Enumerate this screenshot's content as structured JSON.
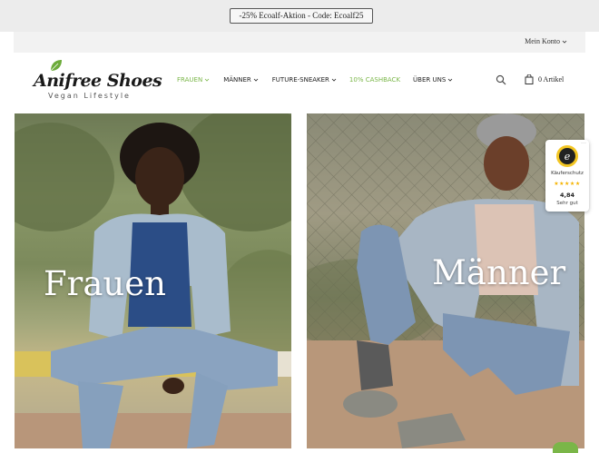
{
  "promo": {
    "text": "-25% Ecoalf-Aktion - Code: Ecoalf25"
  },
  "account": {
    "label": "Mein Konto"
  },
  "logo": {
    "title": "Anifree Shoes",
    "subtitle": "Vegan Lifestyle"
  },
  "nav": {
    "items": [
      {
        "label": "FRAUEN",
        "dropdown": true,
        "color": "#7ab648"
      },
      {
        "label": "MÄNNER",
        "dropdown": true,
        "color": "#222222"
      },
      {
        "label": "FUTURE-SNEAKER",
        "dropdown": true,
        "color": "#222222"
      },
      {
        "label": "10% CASHBACK",
        "dropdown": false,
        "color": "#7ab648"
      },
      {
        "label": "ÜBER UNS",
        "dropdown": true,
        "color": "#222222"
      }
    ]
  },
  "cart": {
    "label": "0 Artikel"
  },
  "panels": {
    "women": {
      "label": "Frauen"
    },
    "men": {
      "label": "Männer"
    }
  },
  "trust_badge": {
    "title": "Käuferschutz",
    "stars": "★★★★★",
    "score": "4,84",
    "rating_text": "Sehr gut"
  },
  "colors": {
    "accent": "#7ab648",
    "promo_bg": "#ececec",
    "account_bg": "#f2f2f2"
  }
}
